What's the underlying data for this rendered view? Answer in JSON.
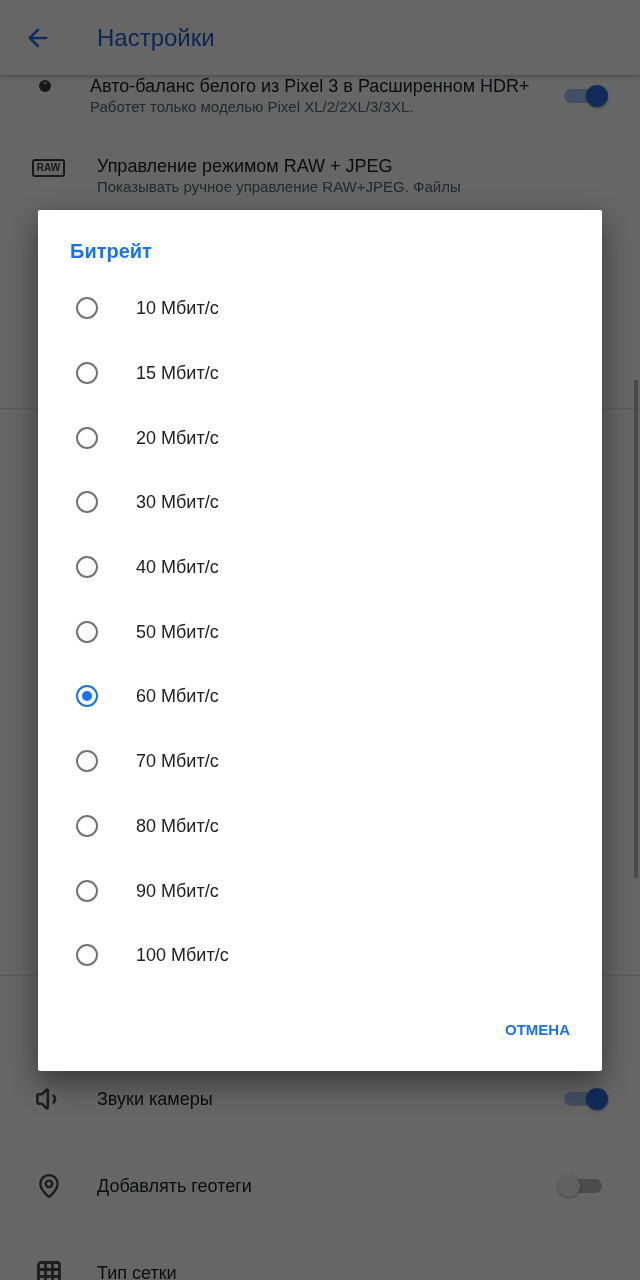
{
  "app_bar": {
    "title": "Настройки"
  },
  "settings": [
    {
      "kind": "toggle",
      "title": "Авто-баланс белого из Pixel 3 в Расширенном HDR+",
      "subtitle": "Работет только моделью Pixel XL/2/2XL/3/3XL.",
      "on": true
    },
    {
      "kind": "plain",
      "badge": "RAW",
      "title": "Управление режимом RAW + JPEG",
      "subtitle": "Показывать ручное управление RAW+JPEG. Файлы"
    }
  ],
  "dialog": {
    "title": "Битрейт",
    "options": [
      {
        "label": "10 Мбит/с",
        "selected": false
      },
      {
        "label": "15 Мбит/с",
        "selected": false
      },
      {
        "label": "20 Мбит/с",
        "selected": false
      },
      {
        "label": "30 Мбит/с",
        "selected": false
      },
      {
        "label": "40 Мбит/с",
        "selected": false
      },
      {
        "label": "50 Мбит/с",
        "selected": false
      },
      {
        "label": "60 Мбит/с",
        "selected": true
      },
      {
        "label": "70 Мбит/с",
        "selected": false
      },
      {
        "label": "80 Мбит/с",
        "selected": false
      },
      {
        "label": "90 Мбит/с",
        "selected": false
      },
      {
        "label": "100 Мбит/с",
        "selected": false
      }
    ],
    "buttons": [
      "ОТМЕНА"
    ]
  },
  "settings_lower": [
    {
      "kind": "toggle",
      "title": "Звуки камеры",
      "on": true
    },
    {
      "kind": "toggle",
      "title": "Добавлять геотеги",
      "on": false
    },
    {
      "kind": "plain",
      "title": "Тип сетки"
    }
  ]
}
